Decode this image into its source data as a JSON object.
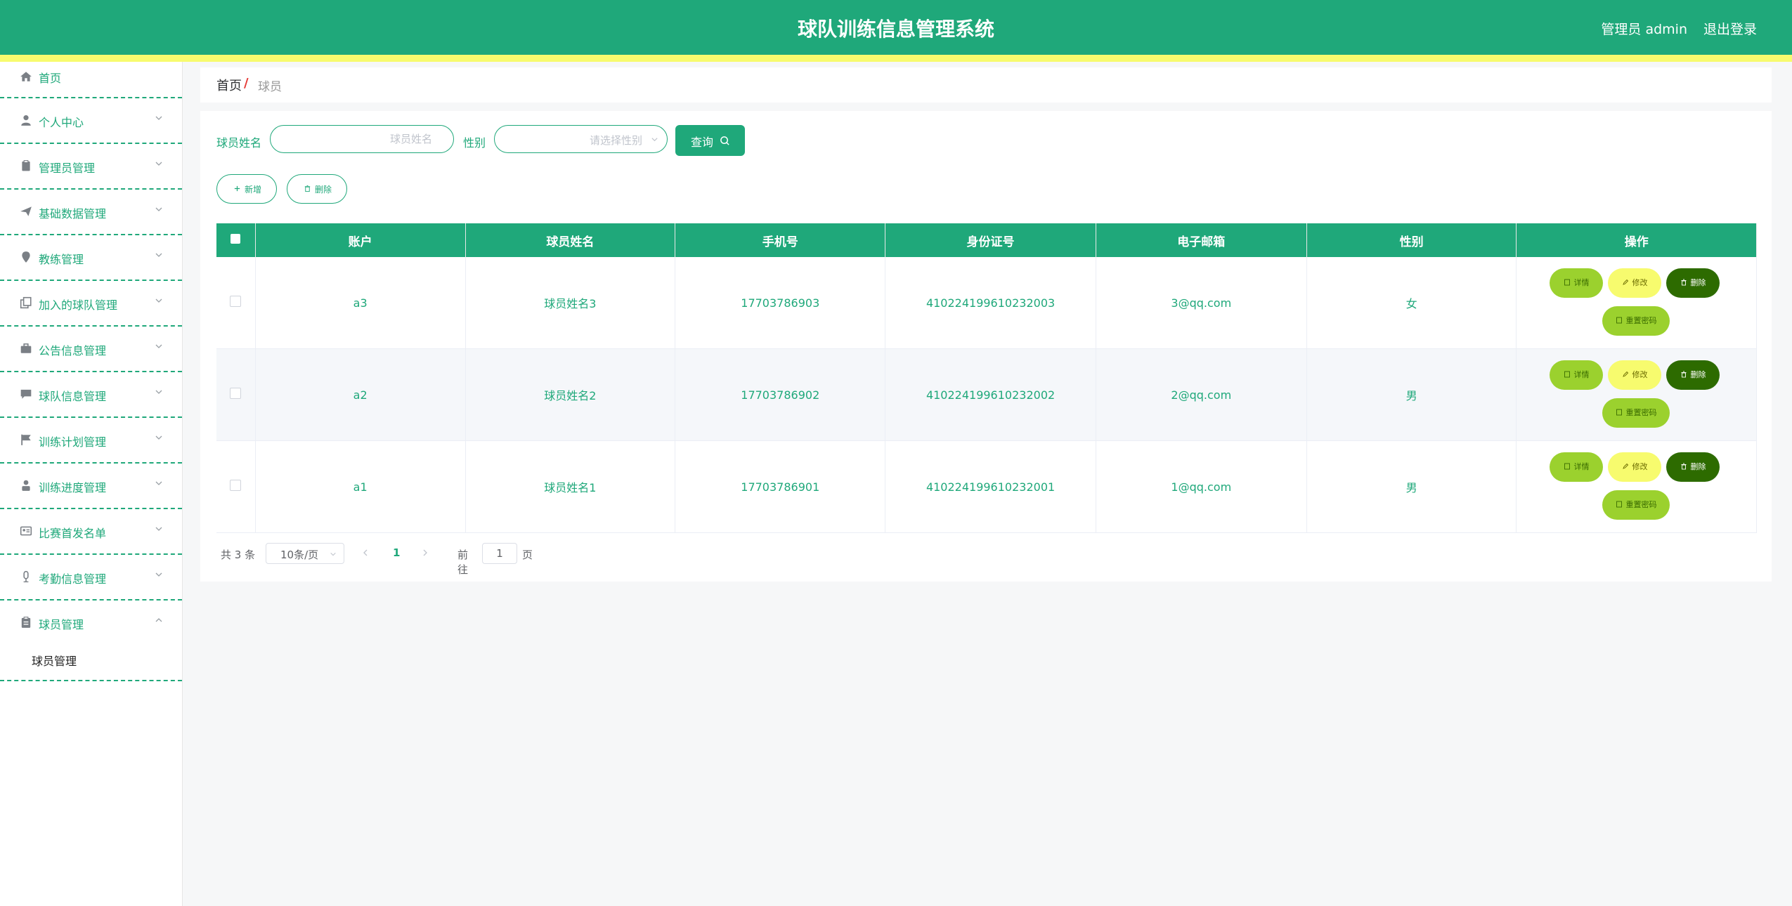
{
  "header": {
    "title": "球队训练信息管理系统",
    "user_label": "管理员 admin",
    "logout_label": "退出登录"
  },
  "sidebar": {
    "items": [
      {
        "label": "首页",
        "icon": "home-icon"
      },
      {
        "label": "个人中心",
        "icon": "user-icon"
      },
      {
        "label": "管理员管理",
        "icon": "clipboard-icon"
      },
      {
        "label": "基础数据管理",
        "icon": "send-icon"
      },
      {
        "label": "教练管理",
        "icon": "location-icon"
      },
      {
        "label": "加入的球队管理",
        "icon": "copy-icon"
      },
      {
        "label": "公告信息管理",
        "icon": "briefcase-icon"
      },
      {
        "label": "球队信息管理",
        "icon": "chat-icon"
      },
      {
        "label": "训练计划管理",
        "icon": "flag-icon"
      },
      {
        "label": "训练进度管理",
        "icon": "person-icon"
      },
      {
        "label": "比赛首发名单",
        "icon": "id-card-icon"
      },
      {
        "label": "考勤信息管理",
        "icon": "microphone-icon"
      },
      {
        "label": "球员管理",
        "icon": "document-icon"
      }
    ],
    "sub_item": "球员管理"
  },
  "breadcrumb": {
    "home": "首页",
    "separator": "/",
    "current": "球员"
  },
  "search": {
    "name_label": "球员姓名",
    "name_placeholder": "球员姓名",
    "gender_label": "性别",
    "gender_placeholder": "请选择性别",
    "query_label": "查询"
  },
  "actions": {
    "add_label": "新增",
    "delete_label": "删除"
  },
  "table": {
    "headers": [
      "账户",
      "球员姓名",
      "手机号",
      "身份证号",
      "电子邮箱",
      "性别",
      "操作"
    ],
    "rows": [
      {
        "account": "a3",
        "name": "球员姓名3",
        "phone": "17703786903",
        "id_card": "410224199610232003",
        "email": "3@qq.com",
        "gender": "女"
      },
      {
        "account": "a2",
        "name": "球员姓名2",
        "phone": "17703786902",
        "id_card": "410224199610232002",
        "email": "2@qq.com",
        "gender": "男"
      },
      {
        "account": "a1",
        "name": "球员姓名1",
        "phone": "17703786901",
        "id_card": "410224199610232001",
        "email": "1@qq.com",
        "gender": "男"
      }
    ],
    "op_labels": {
      "detail": "详情",
      "edit": "修改",
      "delete": "删除",
      "reset": "重置密码"
    }
  },
  "pagination": {
    "total": "共 3 条",
    "page_size": "10条/页",
    "current_page": "1",
    "goto_label": "前往",
    "goto_value": "1",
    "page_unit": "页"
  },
  "colors": {
    "primary": "#1fa87a",
    "accent_yellow": "#f7fb6e",
    "lime": "#9bd12e",
    "dark_green": "#2d6b00"
  }
}
